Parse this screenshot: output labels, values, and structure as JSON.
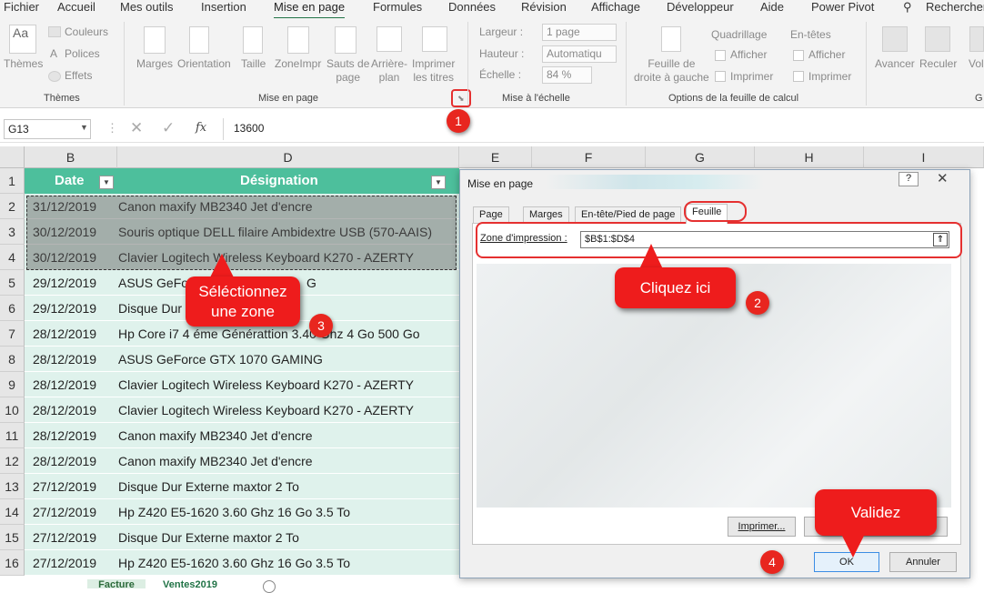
{
  "menu_tabs": [
    "Fichier",
    "Accueil",
    "Mes outils",
    "Insertion",
    "Mise en page",
    "Formules",
    "Données",
    "Révision",
    "Affichage",
    "Développeur",
    "Aide",
    "Power Pivot",
    "Rechercher"
  ],
  "ribbon": {
    "themes": {
      "themes_label": "Thèmes",
      "couleurs": "Couleurs",
      "polices": "Polices",
      "effets": "Effets",
      "group": "Thèmes"
    },
    "page_setup": {
      "marges": "Marges",
      "orientation": "Orientation",
      "taille": "Taille",
      "zone_impr": "ZoneImpr",
      "sauts_1": "Sauts de",
      "sauts_2": "page",
      "arriere_1": "Arrière-",
      "arriere_2": "plan",
      "imprimer_1": "Imprimer",
      "imprimer_2": "les titres",
      "group": "Mise en page"
    },
    "scale": {
      "largeur_label": "Largeur :",
      "largeur_value": "1 page",
      "hauteur_label": "Hauteur :",
      "hauteur_value": "Automatiqu",
      "echelle_label": "Échelle :",
      "echelle_value": "84 %",
      "group": "Mise à l'échelle"
    },
    "sheet_options": {
      "feuille_1": "Feuille de",
      "feuille_2": "droite à gauche",
      "quadrillage": "Quadrillage",
      "entetes": "En-têtes",
      "afficher": "Afficher",
      "imprimer": "Imprimer",
      "group": "Options de la feuille de calcul"
    },
    "arrange": {
      "avancer": "Avancer",
      "reculer": "Reculer",
      "vol": "Vol",
      "g": "G"
    }
  },
  "formula_bar": {
    "name_box": "G13",
    "formula": "13600"
  },
  "columns": [
    "B",
    "D",
    "E",
    "F",
    "G",
    "H",
    "I"
  ],
  "row_numbers": [
    "1",
    "2",
    "3",
    "4",
    "5",
    "6",
    "7",
    "8",
    "9",
    "10",
    "11",
    "12",
    "13",
    "14",
    "15",
    "16"
  ],
  "table": {
    "header": {
      "date": "Date",
      "designation": "Désignation"
    },
    "rows": [
      {
        "date": "31/12/2019",
        "text": "Canon maxify MB2340 Jet d'encre"
      },
      {
        "date": "30/12/2019",
        "text": "Souris optique DELL filaire Ambidextre USB (570-AAIS)"
      },
      {
        "date": "30/12/2019",
        "text": "Clavier Logitech Wireless Keyboard K270 - AZERTY"
      },
      {
        "date": "29/12/2019",
        "text": "ASUS GeFor"
      },
      {
        "date": "29/12/2019",
        "text": "Disque Dur"
      },
      {
        "date": "28/12/2019",
        "text": "Hp Core i7 4 éme Générattion 3.40 Ghz 4 Go 500 Go"
      },
      {
        "date": "28/12/2019",
        "text": "ASUS GeForce GTX 1070 GAMING"
      },
      {
        "date": "28/12/2019",
        "text": "Clavier Logitech Wireless Keyboard K270 - AZERTY"
      },
      {
        "date": "28/12/2019",
        "text": "Clavier Logitech Wireless Keyboard K270 - AZERTY"
      },
      {
        "date": "28/12/2019",
        "text": "Canon maxify MB2340 Jet d'encre"
      },
      {
        "date": "28/12/2019",
        "text": "Canon maxify MB2340 Jet d'encre"
      },
      {
        "date": "27/12/2019",
        "text": "Disque Dur Externe maxtor 2 To"
      },
      {
        "date": "27/12/2019",
        "text": "Hp Z420 E5-1620 3.60 Ghz 16 Go 3.5 To"
      },
      {
        "date": "27/12/2019",
        "text": "Disque Dur Externe maxtor 2 To"
      },
      {
        "date": "27/12/2019",
        "text": "Hp Z420 E5-1620 3.60 Ghz 16 Go 3.5 To"
      }
    ],
    "partial_suffix": "G"
  },
  "dialog": {
    "title": "Mise en page",
    "help": "?",
    "tabs": [
      "Page",
      "Marges",
      "En-tête/Pied de page",
      "Feuille"
    ],
    "zone_label": "Zone d'impression :",
    "zone_value": "$B$1:$D$4",
    "imprimer_btn": "Imprimer...",
    "ok_btn": "OK",
    "annuler_btn": "Annuler"
  },
  "callouts": {
    "select_1": "Séléctionnez",
    "select_2": "une zone",
    "click": "Cliquez ici",
    "validate": "Validez",
    "n1": "1",
    "n2": "2",
    "n3": "3",
    "n4": "4"
  },
  "sheet_tabs": [
    "Facture",
    "Ventes2019"
  ],
  "colors": {
    "accent": "#217346",
    "table_header": "#4dbf9c",
    "table_row": "#dff2ec",
    "callout": "#ee1c1c"
  }
}
